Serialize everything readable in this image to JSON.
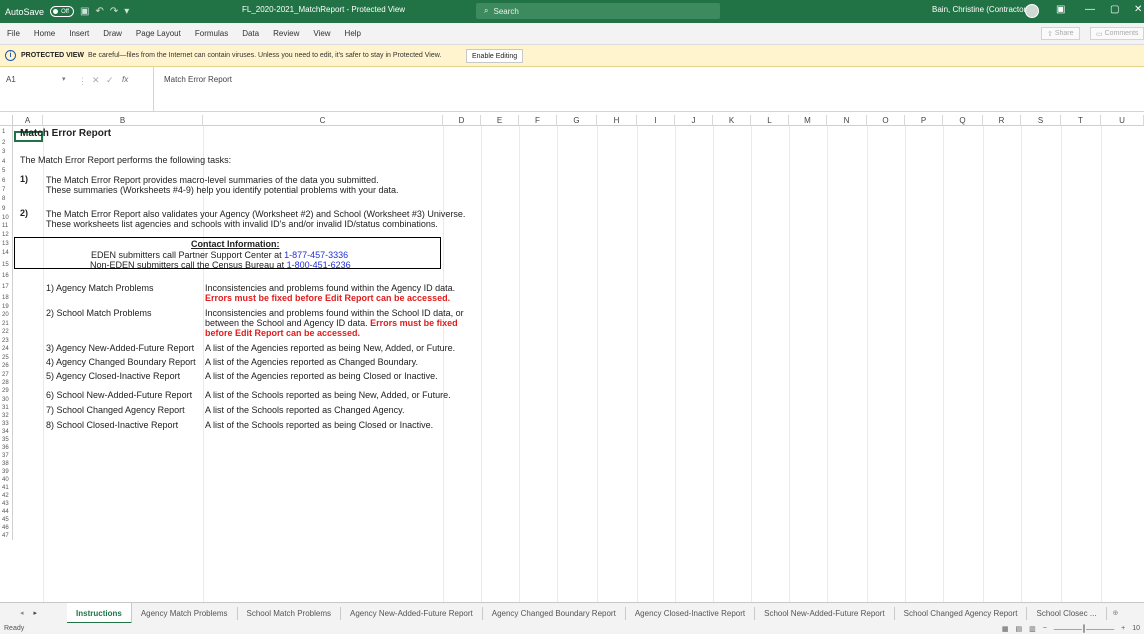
{
  "titlebar": {
    "autosave_label": "AutoSave",
    "autosave_state": "Off",
    "doc_title": "FL_2020-2021_MatchReport - Protected View",
    "search_placeholder": "Search",
    "user_name": "Bain, Christine (Contractor)"
  },
  "menu": {
    "items": [
      "File",
      "Home",
      "Insert",
      "Draw",
      "Page Layout",
      "Formulas",
      "Data",
      "Review",
      "View",
      "Help"
    ],
    "share_label": "Share",
    "comments_label": "Comments"
  },
  "protected": {
    "strong": "PROTECTED VIEW",
    "message": "Be careful—files from the Internet can contain viruses. Unless you need to edit, it's safer to stay in Protected View.",
    "button": "Enable Editing"
  },
  "formula": {
    "name_box": "A1",
    "fx": "fx",
    "content": "Match Error Report"
  },
  "columns": [
    "A",
    "B",
    "C",
    "D",
    "E",
    "F",
    "G",
    "H",
    "I",
    "J",
    "K",
    "L",
    "M",
    "N",
    "O",
    "P",
    "Q",
    "R",
    "S",
    "T",
    "U"
  ],
  "rows": [
    "1",
    "2",
    "3",
    "4",
    "5",
    "6",
    "7",
    "8",
    "9",
    "10",
    "11",
    "12",
    "13",
    "14",
    "15",
    "16",
    "17",
    "18",
    "19",
    "20",
    "21",
    "22",
    "23",
    "24",
    "25",
    "26",
    "27",
    "28",
    "29",
    "30",
    "31",
    "32",
    "33",
    "34",
    "35",
    "36",
    "37",
    "38",
    "39",
    "40",
    "41",
    "42",
    "43",
    "44",
    "45",
    "46",
    "47"
  ],
  "sheet": {
    "title": "Match Error Report",
    "intro": "The Match Error Report performs the following tasks:",
    "n1": "1)",
    "n1_line1": "The Match Error Report provides macro-level summaries of the data you submitted.",
    "n1_line2": "These summaries (Worksheets #4-9) help you identify potential problems with your data.",
    "n2": "2)",
    "n2_line1": "The Match Error Report also validates your Agency (Worksheet #2) and School (Worksheet #3) Universe.",
    "n2_line2": "These worksheets list agencies and schools with invalid ID's and/or invalid ID/status combinations.",
    "contact_title": "Contact Information:",
    "contact_eden": "EDEN submitters call Partner Support Center at ",
    "contact_eden_phone": "1-877-457-3336",
    "contact_noneden": "Non-EDEN submitters call the Census Bureau at ",
    "contact_noneden_phone": "1-800-451-6236",
    "items": [
      {
        "name": "1) Agency Match Problems",
        "desc": "Inconsistencies and problems found within the Agency ID data.",
        "desc_red": "Errors must be fixed before Edit Report can be accessed."
      },
      {
        "name": "2) School Match Problems",
        "desc1": "Inconsistencies and problems found within the School ID data, or",
        "desc2": "between the School and Agency ID data.",
        "desc2_red": "Errors must be fixed",
        "desc3_red": "before Edit Report can be accessed."
      },
      {
        "name": "3) Agency New-Added-Future Report",
        "desc": "A list of the Agencies reported as being New, Added, or Future."
      },
      {
        "name": "4) Agency Changed Boundary Report",
        "desc": "A list of the Agencies reported as Changed Boundary."
      },
      {
        "name": "5) Agency Closed-Inactive Report",
        "desc": "A list of the Agencies reported as being Closed or Inactive."
      },
      {
        "name": "6) School New-Added-Future Report",
        "desc": "A list of the Schools reported as being New, Added, or Future."
      },
      {
        "name": "7) School Changed Agency Report",
        "desc": "A list of the Schools reported as Changed Agency."
      },
      {
        "name": "8) School Closed-Inactive Report",
        "desc": "A list of the Schools reported as being Closed or Inactive."
      }
    ]
  },
  "tabs": [
    "Instructions",
    "Agency Match Problems",
    "School Match Problems",
    "Agency New-Added-Future Report",
    "Agency Changed Boundary Report",
    "Agency Closed-Inactive Report",
    "School New-Added-Future Report",
    "School Changed Agency Report",
    "School Closec ..."
  ],
  "status": {
    "ready": "Ready",
    "zoom": "10"
  },
  "colors": {
    "excel_green": "#217346",
    "error_red": "#e21c1c",
    "link_blue": "#2230d8",
    "protected_bg": "#fff4ce"
  }
}
